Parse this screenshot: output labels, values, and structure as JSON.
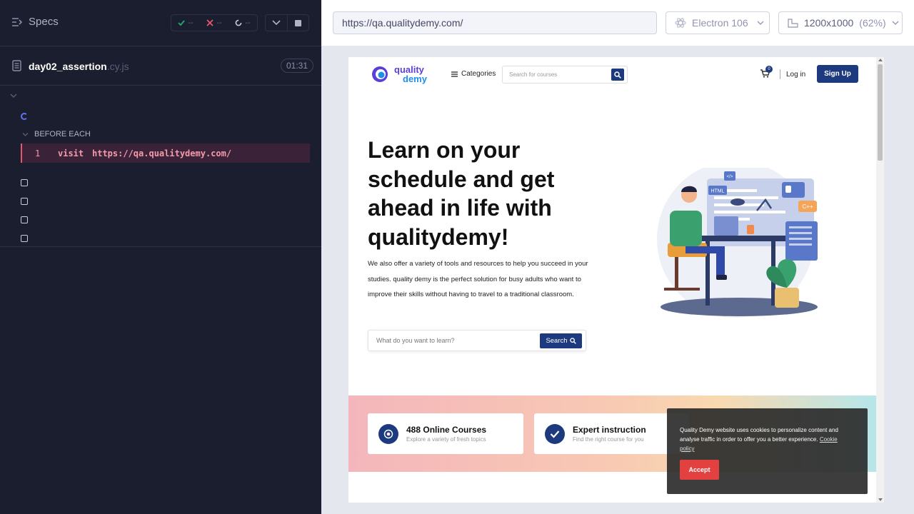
{
  "runner": {
    "specs_label": "Specs",
    "stats": {
      "passed": "--",
      "failed": "--",
      "pending": "--"
    },
    "spec_file": {
      "name": "day02_assertion",
      "ext": ".cy.js",
      "duration": "01:31"
    },
    "hook_label": "BEFORE EACH",
    "command": {
      "number": "1",
      "name": "visit",
      "arg": "https://qa.qualitydemy.com/"
    }
  },
  "aut_header": {
    "url": "https://qa.qualitydemy.com/",
    "browser": "Electron 106",
    "viewport": "1200x1000",
    "scale": "(62%)"
  },
  "site": {
    "logo_line1": "quality",
    "logo_line2": "demy",
    "categories": "Categories",
    "search_placeholder": "Search for courses",
    "cart_count": "0",
    "login": "Log in",
    "signup": "Sign Up",
    "hero_title": "Learn on your schedule and get ahead in life with qualitydemy!",
    "hero_desc": "We also offer a variety of tools and resources to help you succeed in your studies. quality demy is the perfect solution for busy adults who want to improve their skills without having to travel to a traditional classroom.",
    "learn_placeholder": "What do you want to learn?",
    "learn_button": "Search",
    "cards": [
      {
        "title": "488 Online Courses",
        "subtitle": "Explore a variety of fresh topics"
      },
      {
        "title": "Expert instruction",
        "subtitle": "Find the right course for you"
      }
    ],
    "cookie_text": "Quality Demy website uses cookies to personalize content and analyse traffic in order to offer you a better experience.",
    "cookie_link": "Cookie policy",
    "cookie_accept": "Accept",
    "illus_tags": {
      "html": "HTML",
      "code": "</>",
      "cpp": "C++"
    }
  },
  "colors": {
    "runner_bg": "#1b1e2e",
    "brand_navy": "#1d3a7e",
    "fail_red": "#e45770",
    "accept_red": "#e2413f"
  }
}
